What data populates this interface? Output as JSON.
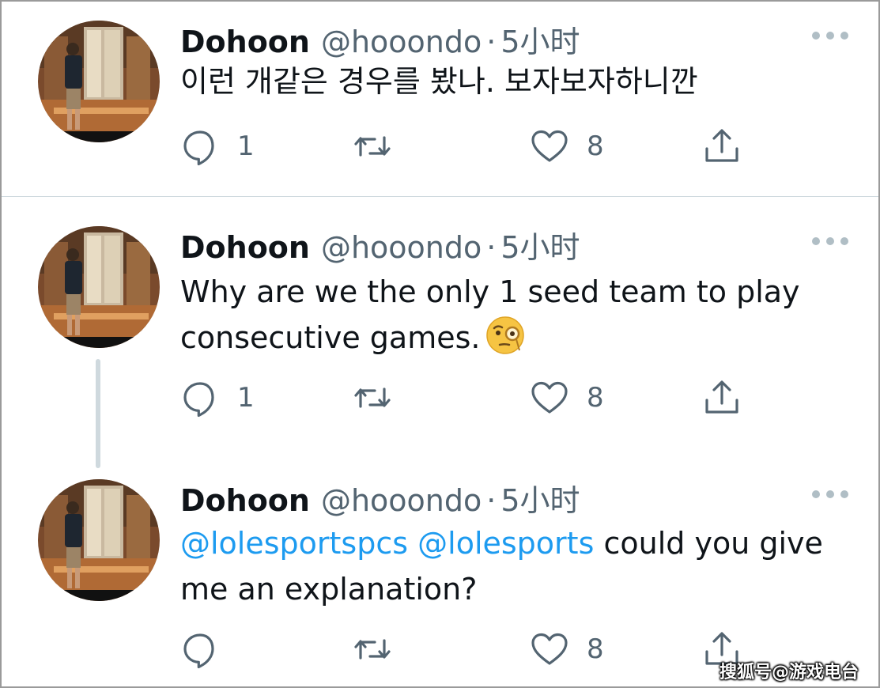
{
  "tweets": [
    {
      "name": "Dohoon",
      "handle": "@hooondo",
      "separator": "·",
      "time": "5小时",
      "text": "이런 개같은 경우를 봤나. 보자보자하니깐",
      "reply_count": "1",
      "retweet_count": "",
      "like_count": "8"
    },
    {
      "name": "Dohoon",
      "handle": "@hooondo",
      "separator": "·",
      "time": "5小时",
      "text": "Why are we the only 1 seed team to play consecutive games.",
      "emoji": "face-with-monocle-emoji",
      "reply_count": "1",
      "retweet_count": "",
      "like_count": "8"
    },
    {
      "name": "Dohoon",
      "handle": "@hooondo",
      "separator": "·",
      "time": "5小时",
      "mention_1": "@lolesportspcs",
      "mention_2": "@lolesports",
      "text_rest": "could you give me an explanation?",
      "reply_count": "",
      "retweet_count": "",
      "like_count": "8"
    }
  ],
  "watermark": "搜狐号@游戏电台",
  "icons": [
    "reply-icon",
    "retweet-icon",
    "like-icon",
    "share-icon",
    "more-icon"
  ],
  "colors": {
    "mention": "#1d9bf0",
    "secondary_text": "#536471",
    "divider": "#cfd9de"
  }
}
